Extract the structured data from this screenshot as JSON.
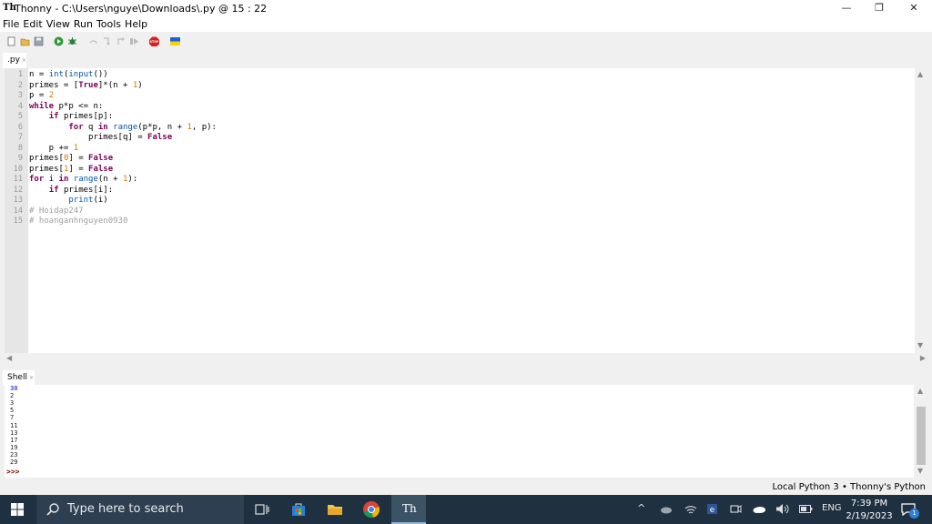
{
  "window": {
    "app_icon": "Th",
    "title": "Thonny  -  C:\\Users\\nguye\\Downloads\\.py  @  15 : 22",
    "minimize": "—",
    "restore": "❐",
    "close": "✕"
  },
  "menu": [
    "File",
    "Edit",
    "View",
    "Run",
    "Tools",
    "Help"
  ],
  "toolbar": {
    "icons": [
      "new-file-icon",
      "open-file-icon",
      "save-icon",
      "run-icon",
      "debug-icon",
      "step-over-icon",
      "step-into-icon",
      "step-out-icon",
      "resume-icon",
      "stop-icon",
      "ukraine-flag-icon"
    ],
    "stop_label": "STOP"
  },
  "editor": {
    "tab_label": ".py",
    "tab_close": "×",
    "lines": [
      {
        "n": "1",
        "code": "n = int(input())"
      },
      {
        "n": "2",
        "code": "primes = [True]*(n + 1)"
      },
      {
        "n": "3",
        "code": "p = 2"
      },
      {
        "n": "4",
        "code": "while p*p <= n:"
      },
      {
        "n": "5",
        "code": "    if primes[p]:"
      },
      {
        "n": "6",
        "code": "        for q in range(p*p, n + 1, p):"
      },
      {
        "n": "7",
        "code": "            primes[q] = False"
      },
      {
        "n": "8",
        "code": "    p += 1"
      },
      {
        "n": "9",
        "code": "primes[0] = False"
      },
      {
        "n": "10",
        "code": "primes[1] = False"
      },
      {
        "n": "11",
        "code": "for i in range(n + 1):"
      },
      {
        "n": "12",
        "code": "    if primes[i]:"
      },
      {
        "n": "13",
        "code": "        print(i)"
      },
      {
        "n": "14",
        "code": "# Hoidap247"
      },
      {
        "n": "15",
        "code": "# hoanganhnguyen0930"
      }
    ]
  },
  "shell": {
    "tab_label": "Shell",
    "tab_close": "×",
    "input": "30",
    "output": [
      "2",
      "3",
      "5",
      "7",
      "11",
      "13",
      "17",
      "19",
      "23",
      "29"
    ],
    "prompt": ">>>"
  },
  "status": {
    "text": "Local Python 3  •  Thonny's Python"
  },
  "taskbar": {
    "search_placeholder": "Type here to search",
    "tray_lang": "ENG",
    "time": "7:39 PM",
    "date": "2/19/2023",
    "notification_count": "1"
  },
  "colors": {
    "keyword": "#7f0055",
    "builtin": "#0055aa",
    "number": "#cc7a00",
    "comment": "#a0a0a0",
    "taskbar": "#1f3040"
  }
}
